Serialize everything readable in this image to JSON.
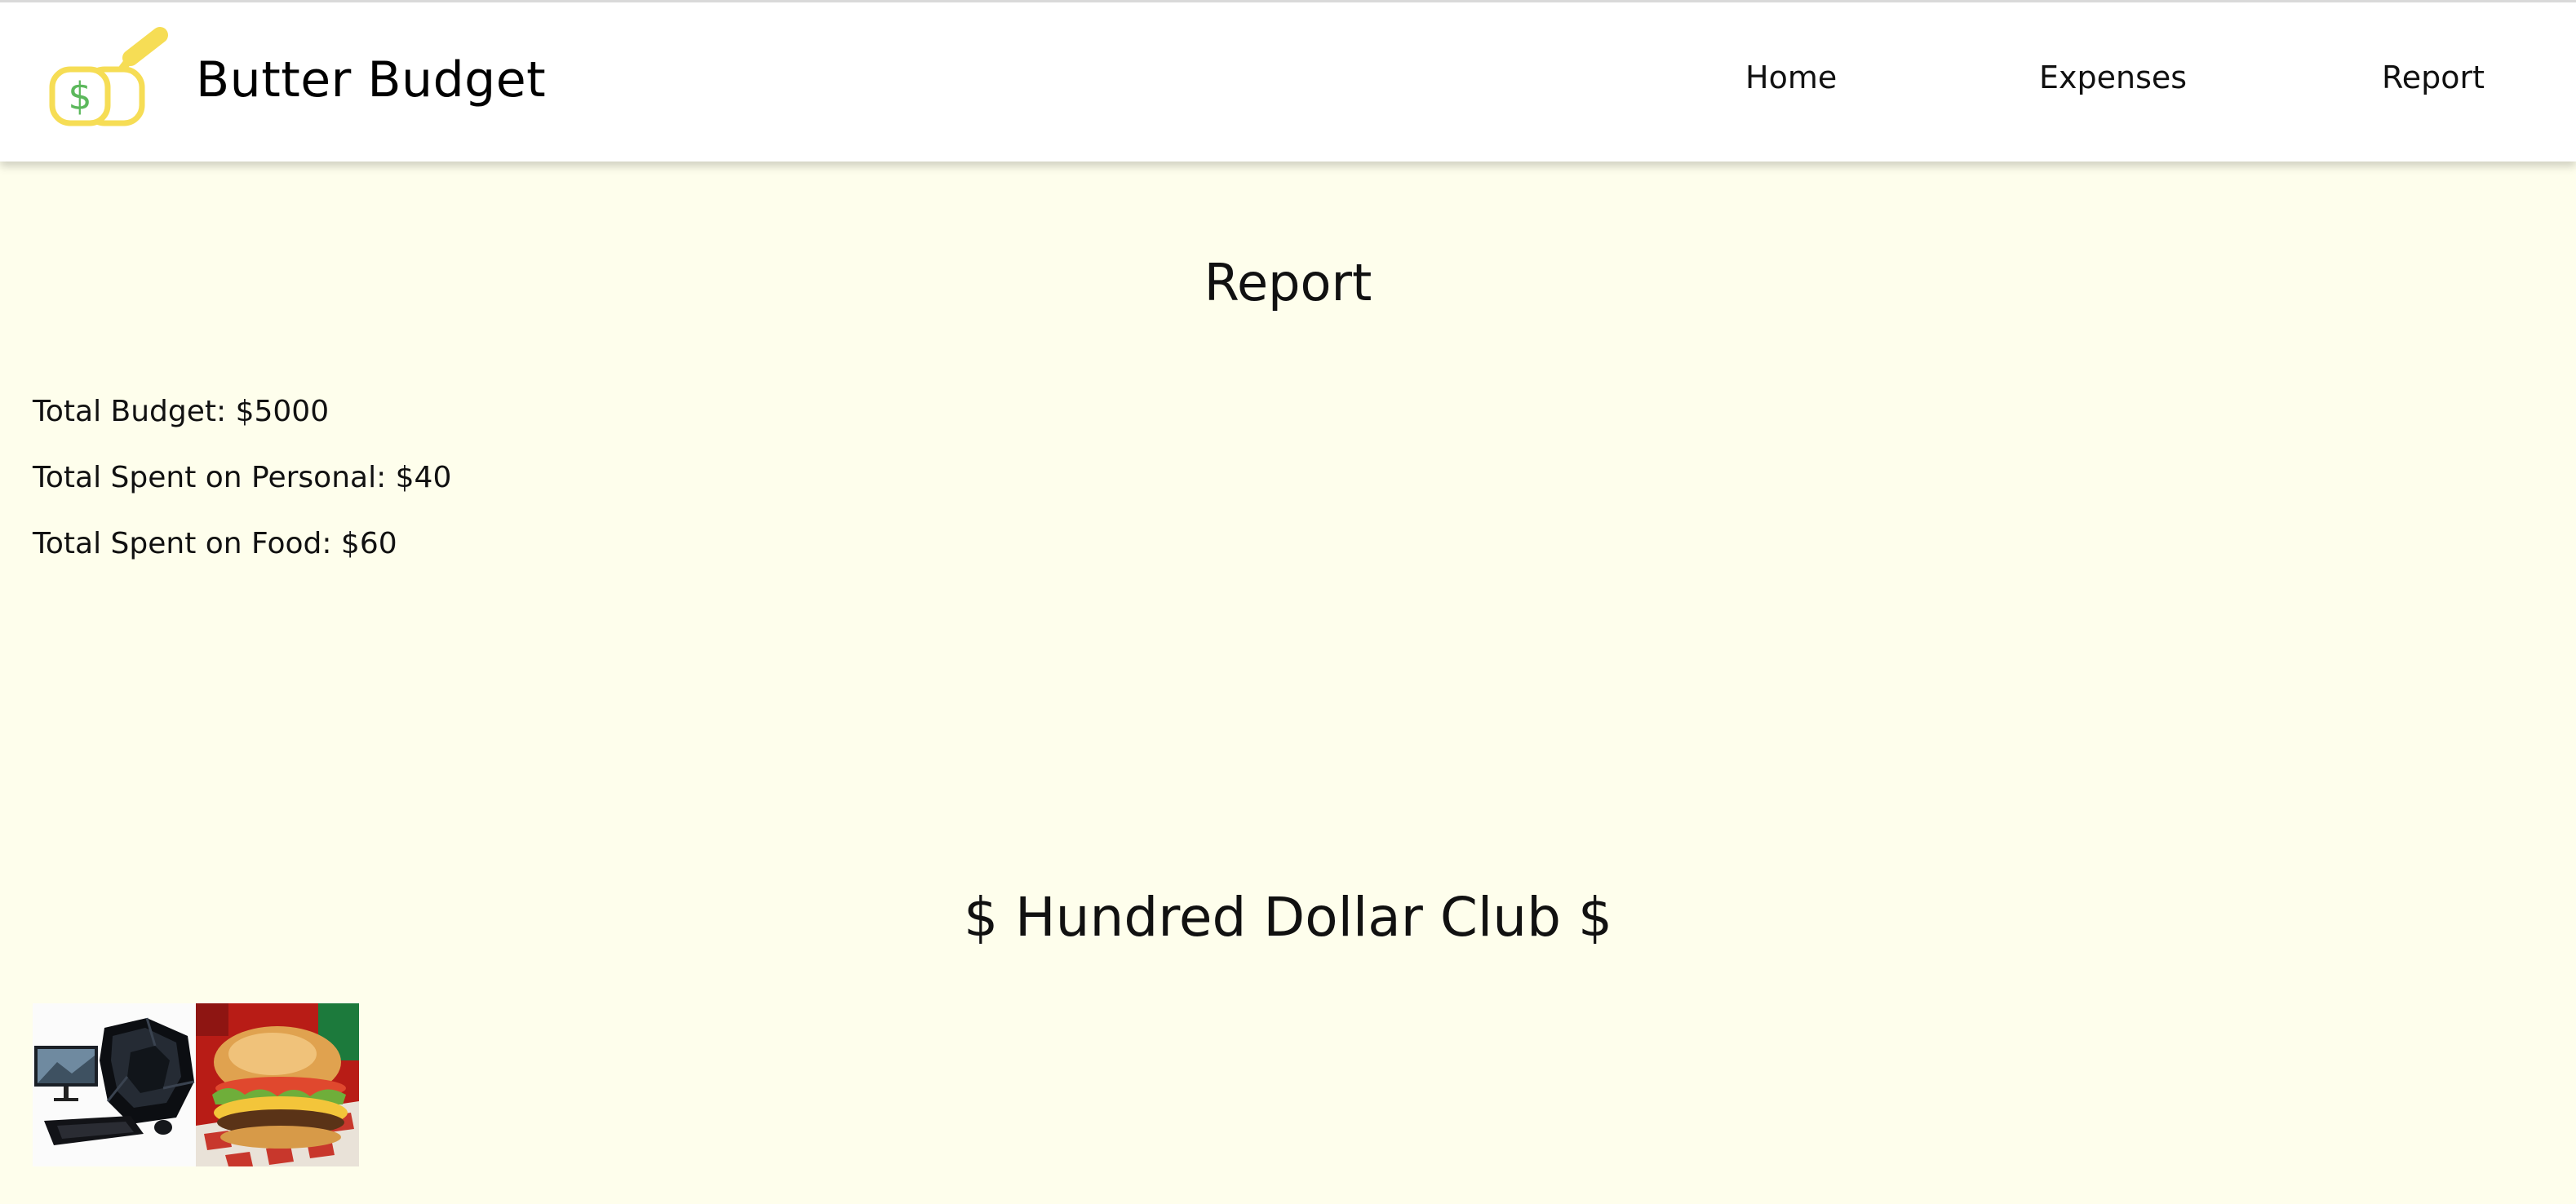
{
  "header": {
    "brand_name": "Butter Budget",
    "nav": {
      "home": "Home",
      "expenses": "Expenses",
      "report": "Report"
    }
  },
  "main": {
    "title": "Report",
    "stats": [
      "Total Budget: $5000",
      "Total Spent on Personal: $40",
      "Total Spent on Food: $60"
    ],
    "club_title": "$ Hundred Dollar Club $"
  },
  "colors": {
    "page_background": "#fefeec",
    "navbar_background": "#ffffff",
    "logo_yellow": "#f6dd55",
    "logo_green": "#5cb85c"
  },
  "icons": {
    "logo": "butter-dollar-logo",
    "thumb_1": "gaming-pc-image",
    "thumb_2": "burger-image"
  }
}
